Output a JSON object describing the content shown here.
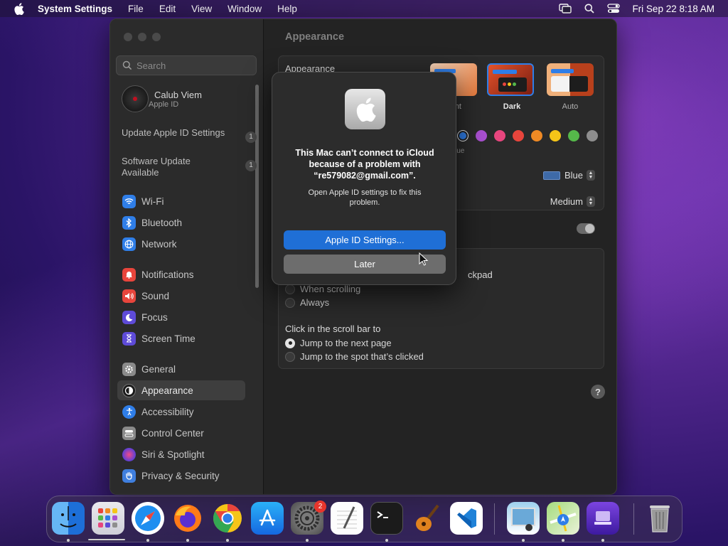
{
  "menubar": {
    "app_name": "System Settings",
    "menus": [
      "File",
      "Edit",
      "View",
      "Window",
      "Help"
    ],
    "datetime": "Fri Sep 22  8:18 AM",
    "icons": [
      "apple-icon",
      "screen-mirroring-icon",
      "spotlight-search-icon",
      "control-center-icon"
    ]
  },
  "sidebar": {
    "search_placeholder": "Search",
    "profile": {
      "name": "Calub Viem",
      "subtitle": "Apple ID"
    },
    "notices": [
      {
        "label": "Update Apple ID Settings",
        "count": "1"
      },
      {
        "label": "Software Update Available",
        "count": "1"
      }
    ],
    "items": [
      {
        "label": "Wi-Fi",
        "color": "#2f7ee8"
      },
      {
        "label": "Bluetooth",
        "color": "#2f7ee8"
      },
      {
        "label": "Network",
        "color": "#2f7ee8"
      },
      {
        "label": "Notifications",
        "color": "#e8453c"
      },
      {
        "label": "Sound",
        "color": "#e8453c"
      },
      {
        "label": "Focus",
        "color": "#5e4bd8"
      },
      {
        "label": "Screen Time",
        "color": "#5e4bd8"
      },
      {
        "label": "General",
        "color": "#8a8a8a"
      },
      {
        "label": "Appearance",
        "color": "#1b1b1b",
        "selected": true
      },
      {
        "label": "Accessibility",
        "color": "#2f7ee8"
      },
      {
        "label": "Control Center",
        "color": "#8a8a8a"
      },
      {
        "label": "Siri & Spotlight",
        "color": "#c44bd8"
      },
      {
        "label": "Privacy & Security",
        "color": "#3f7fdf"
      }
    ]
  },
  "main": {
    "title": "Appearance",
    "appearance_row_label": "Appearance",
    "modes": [
      {
        "label": "nt"
      },
      {
        "label": "Dark",
        "selected": true
      },
      {
        "label": "Auto"
      }
    ],
    "accent_colors": [
      "#2f7ee8",
      "#a950d0",
      "#e8467e",
      "#e8453c",
      "#f08a24",
      "#f5c518",
      "#55b84a",
      "#8e8e8e"
    ],
    "accent_selected_label": "lue",
    "highlight_color": "Blue",
    "sidebar_icon_size": "Medium",
    "scrollbar_label_fragment": "ckpad",
    "show_scroll_options": [
      "When scrolling",
      "Always"
    ],
    "click_scroll_label": "Click in the scroll bar to",
    "click_scroll_options": [
      {
        "label": "Jump to the next page",
        "selected": true
      },
      {
        "label": "Jump to the spot that’s clicked",
        "selected": false
      }
    ],
    "help": "?"
  },
  "dialog": {
    "title": "This Mac can’t connect to iCloud because of a problem with “re579082@gmail.com”.",
    "message": "Open Apple ID settings to fix this problem.",
    "primary_button": "Apple ID Settings...",
    "secondary_button": "Later"
  },
  "dock": {
    "apps": [
      "finder-icon",
      "launchpad-icon",
      "safari-icon",
      "firefox-icon",
      "chrome-icon",
      "app-store-icon",
      "system-settings-icon",
      "textedit-icon",
      "terminal-icon",
      "garageband-icon",
      "vscode-icon",
      "preview-icon",
      "maps-icon",
      "screen-sharing-icon",
      "trash-icon"
    ],
    "settings_badge": "2"
  },
  "colors": {
    "accent": "#1f6fd6",
    "window_bg": "#232323",
    "sidebar_bg": "#2b2b2b"
  }
}
